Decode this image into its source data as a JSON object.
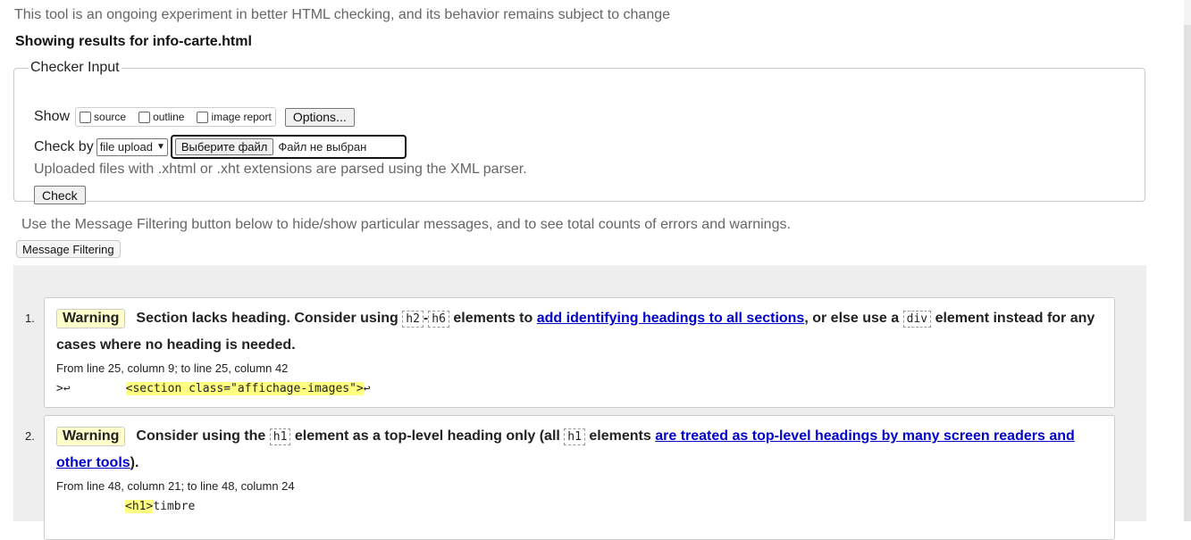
{
  "notice": "This tool is an ongoing experiment in better HTML checking, and its behavior remains subject to change",
  "results_title": "Showing results for info-carte.html",
  "checker": {
    "legend": "Checker Input",
    "show_label": "Show",
    "show_options": [
      "source",
      "outline",
      "image report"
    ],
    "options_button": "Options...",
    "check_by_label": "Check by",
    "check_by_value": "file upload",
    "file_button": "Выберите файл",
    "file_status": "Файл не выбран",
    "upload_note": "Uploaded files with .xhtml or .xht extensions are parsed using the XML parser.",
    "check_button": "Check"
  },
  "filter_note": "Use the Message Filtering button below to hide/show particular messages, and to see total counts of errors and warnings.",
  "filter_button": "Message Filtering",
  "messages": [
    {
      "num": "1.",
      "type": "Warning",
      "t1": "Section lacks heading. Consider using",
      "c1": "h2",
      "dash": "-",
      "c2": "h6",
      "t2": "elements to",
      "link": "add identifying headings to all sections",
      "t3": ", or else use a",
      "c3": "div",
      "t4": "element instead for any cases where no heading is needed.",
      "loc": "From line 25, column 9; to line 25, column 42",
      "ext_pre": ">↩",
      "ext_hl": "<section class=\"affichage-images\">",
      "ext_post": "↩"
    },
    {
      "num": "2.",
      "type": "Warning",
      "t1": "Consider using the",
      "c1": "h1",
      "t2": "element as a top-level heading only (all",
      "c2": "h1",
      "t3": "elements",
      "link": "are treated as top-level headings by many screen readers and other tools",
      "t4": ").",
      "loc": "From line 48, column 21; to line 48, column 24",
      "ext_hl": "<h1>",
      "ext_post": "timbre"
    }
  ]
}
